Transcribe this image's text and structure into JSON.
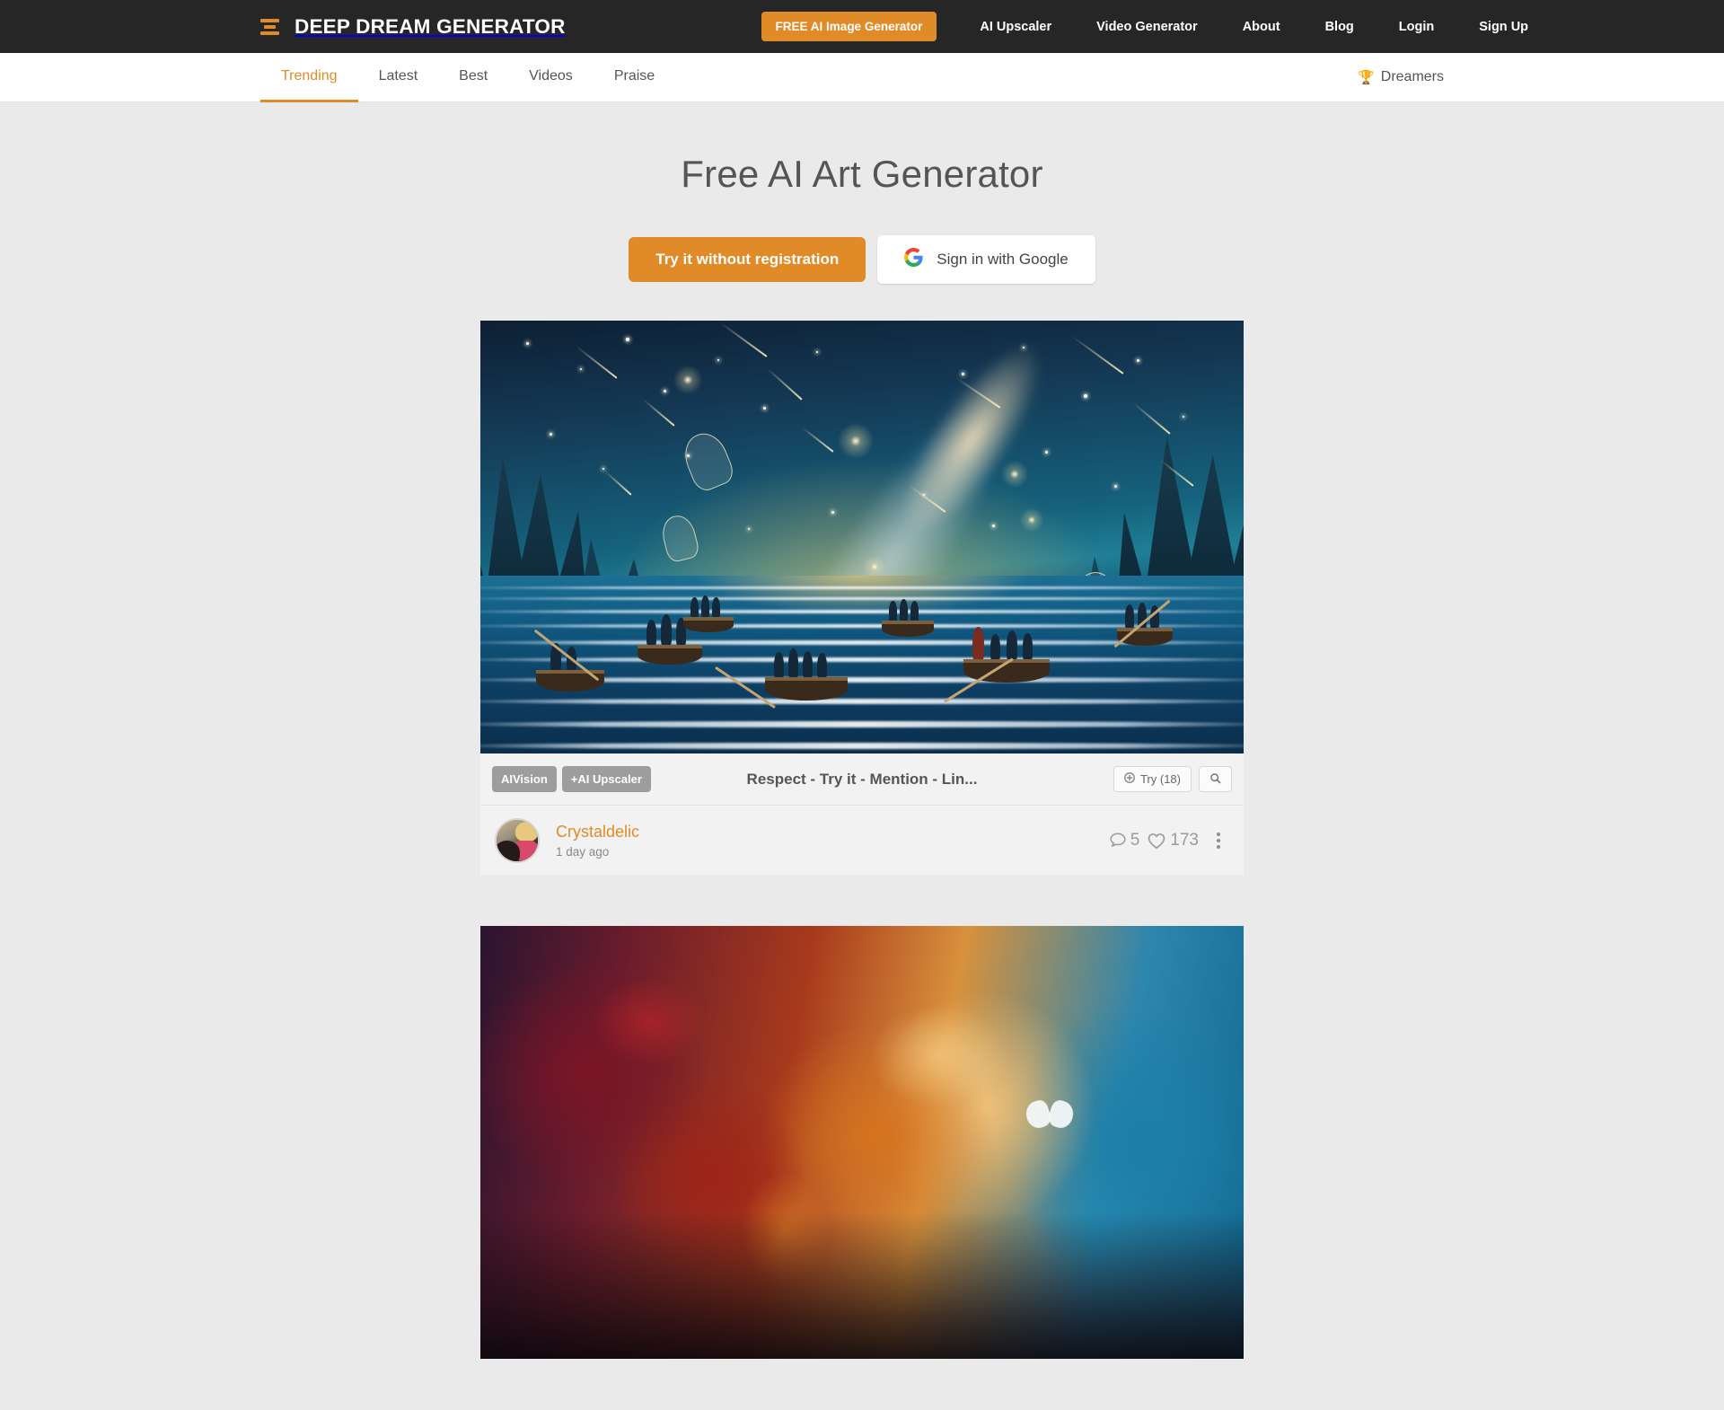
{
  "brand": {
    "name": "DEEP DREAM GENERATOR",
    "logo_icon": "stacked-bars-logo-icon",
    "accent_color": "#e08b28"
  },
  "topnav": {
    "cta_label": "FREE AI Image Generator",
    "items": [
      {
        "label": "AI Upscaler"
      },
      {
        "label": "Video Generator"
      },
      {
        "label": "About"
      },
      {
        "label": "Blog"
      },
      {
        "label": "Login"
      },
      {
        "label": "Sign Up"
      }
    ]
  },
  "subnav": {
    "tabs": [
      {
        "label": "Trending",
        "active": true
      },
      {
        "label": "Latest",
        "active": false
      },
      {
        "label": "Best",
        "active": false
      },
      {
        "label": "Videos",
        "active": false
      },
      {
        "label": "Praise",
        "active": false
      }
    ],
    "dreamers_label": "Dreamers",
    "dreamers_icon": "trophy-icon"
  },
  "hero": {
    "title": "Free AI Art Generator",
    "primary_button": "Try it without registration",
    "google_button": "Sign in with Google",
    "google_icon": "google-g-icon"
  },
  "feed": {
    "cards": [
      {
        "artwork_alt": "Starry night seascape with boats, Milky Way and shooting stars",
        "tags": [
          "AIVision",
          "+AI Upscaler"
        ],
        "title": "Respect - Try it - Mention - Lin...",
        "try_button": "Try (18)",
        "try_icon": "plus-circle-icon",
        "search_icon": "magnifier-icon",
        "author": "Crystaldelic",
        "time": "1 day ago",
        "comments": "5",
        "comments_icon": "comment-bubble-icon",
        "likes": "173",
        "likes_icon": "heart-icon",
        "menu_icon": "kebab-menu-icon"
      },
      {
        "artwork_alt": "Abstract impressionist landscape in red, orange and blue with a white butterfly"
      }
    ]
  }
}
